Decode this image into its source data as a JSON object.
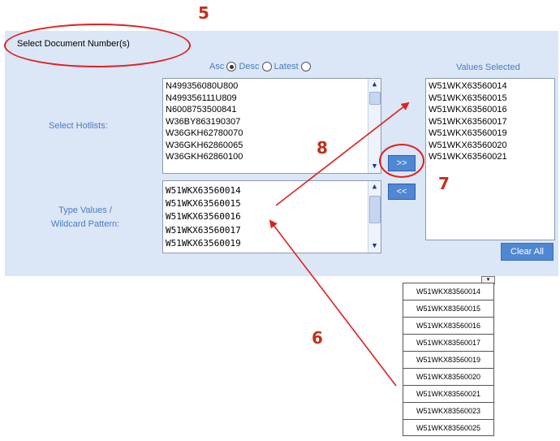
{
  "annotations": {
    "step5": "5",
    "step6": "6",
    "step7": "7",
    "step8": "8"
  },
  "header": {
    "title": "Select Document Number(s)"
  },
  "sort": {
    "asc": "Asc",
    "desc": "Desc",
    "latest": "Latest",
    "selected": "asc"
  },
  "hotlists": {
    "label": "Select Hotlists:",
    "items": [
      "N499356080U800",
      "N499356111U809",
      "N6008753500841",
      "W36BY863190307",
      "W36GKH62780070",
      "W36GKH62860065",
      "W36GKH62860100"
    ]
  },
  "type_values": {
    "label_line1": "Type Values /",
    "label_line2": "Wildcard Pattern:",
    "items": [
      "W51WKX63560014",
      "W51WKX63560015",
      "W51WKX63560016",
      "W51WKX63560017",
      "W51WKX63560019"
    ]
  },
  "buttons": {
    "add": ">>",
    "remove": "<<",
    "clear_all": "Clear All"
  },
  "selected": {
    "label": "Values Selected",
    "items": [
      "W51WKX63560014",
      "W51WKX63560015",
      "W51WKX63560016",
      "W51WKX63560017",
      "W51WKX63560019",
      "W51WKX63560020",
      "W51WKX63560021"
    ]
  },
  "source_column": {
    "items": [
      "W51WKX83560014",
      "W51WKX83560015",
      "W51WKX83560016",
      "W51WKX83560017",
      "W51WKX83560019",
      "W51WKX83560020",
      "W51WKX83560021",
      "W51WKX83560023",
      "W51WKX83560025"
    ]
  },
  "colors": {
    "panel": "#dbe6f6",
    "annotation_red": "#e02020",
    "label_blue": "#4a7cc0",
    "button_blue": "#4f87d3"
  }
}
